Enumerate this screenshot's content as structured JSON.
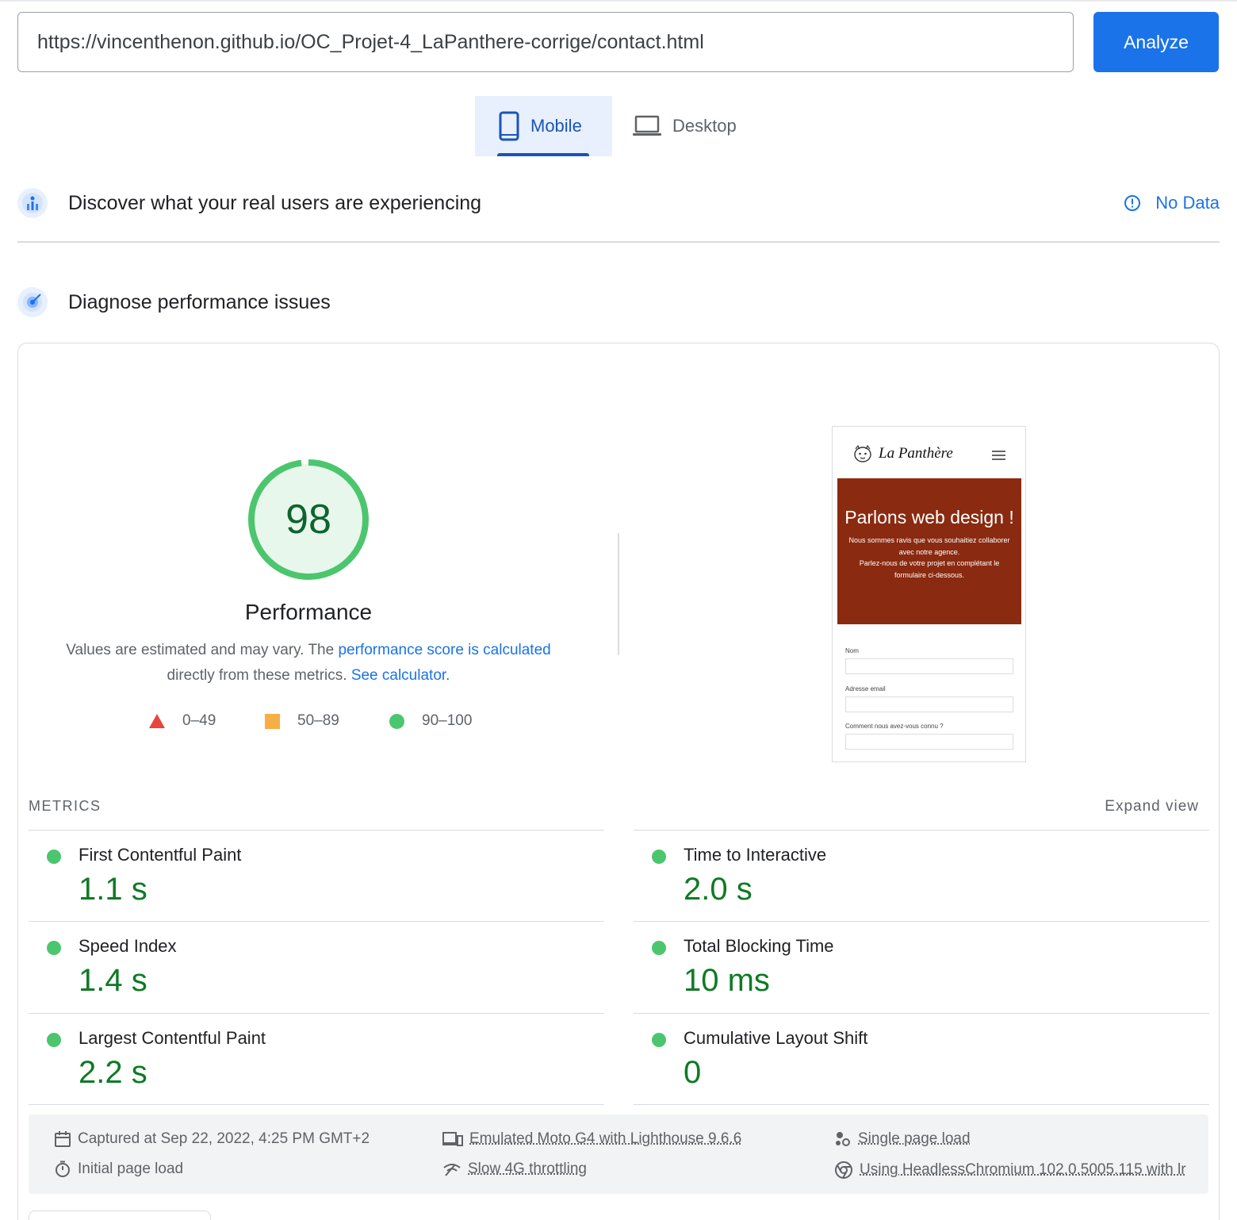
{
  "search": {
    "url": "https://vincenthenon.github.io/OC_Projet-4_LaPanthere-corrige/contact.html",
    "analyze_label": "Analyze"
  },
  "tabs": [
    {
      "label": "Mobile",
      "selected": true
    },
    {
      "label": "Desktop",
      "selected": false
    }
  ],
  "field_data": {
    "title": "Discover what your real users are experiencing",
    "status": "No Data"
  },
  "diagnose": {
    "title": "Diagnose performance issues"
  },
  "performance": {
    "score": "98",
    "score_value": 98,
    "title": "Performance",
    "desc_prefix": "Values are estimated and may vary. The ",
    "desc_link1": "performance score is calculated",
    "desc_middle": "directly from these metrics. ",
    "desc_link2": "See calculator.",
    "color_good": "#4cc66e"
  },
  "legend": [
    {
      "range": "0–49",
      "color": "#e8453c"
    },
    {
      "range": "50–89",
      "color": "#f6ae45"
    },
    {
      "range": "90–100",
      "color": "#4cc66e"
    }
  ],
  "screenshot": {
    "logo": "La Panthère",
    "hero_title": "Parlons web design !",
    "hero_text_1": "Nous sommes ravis que vous souhaitiez collaborer avec notre agence.",
    "hero_text_2": "Parlez-nous de votre projet en complétant le formulaire ci-dessous.",
    "field_1": "Nom",
    "field_2": "Adresse email",
    "field_3": "Comment nous avez-vous connu ?"
  },
  "metrics": {
    "label": "METRICS",
    "expand": "Expand view",
    "items": [
      {
        "name": "First Contentful Paint",
        "value": "1.1 s"
      },
      {
        "name": "Time to Interactive",
        "value": "2.0 s"
      },
      {
        "name": "Speed Index",
        "value": "1.4 s"
      },
      {
        "name": "Total Blocking Time",
        "value": "10 ms"
      },
      {
        "name": "Largest Contentful Paint",
        "value": "2.2 s"
      },
      {
        "name": "Cumulative Layout Shift",
        "value": "0"
      }
    ]
  },
  "info": {
    "captured": "Captured at Sep 22, 2022, 4:25 PM GMT+2",
    "initial_load": "Initial page load",
    "emulated": "Emulated Moto G4 with Lighthouse 9.6.6",
    "throttling": "Slow 4G throttling",
    "single_load": "Single page load",
    "browser": "Using HeadlessChromium 102.0.5005.115 with lr"
  }
}
